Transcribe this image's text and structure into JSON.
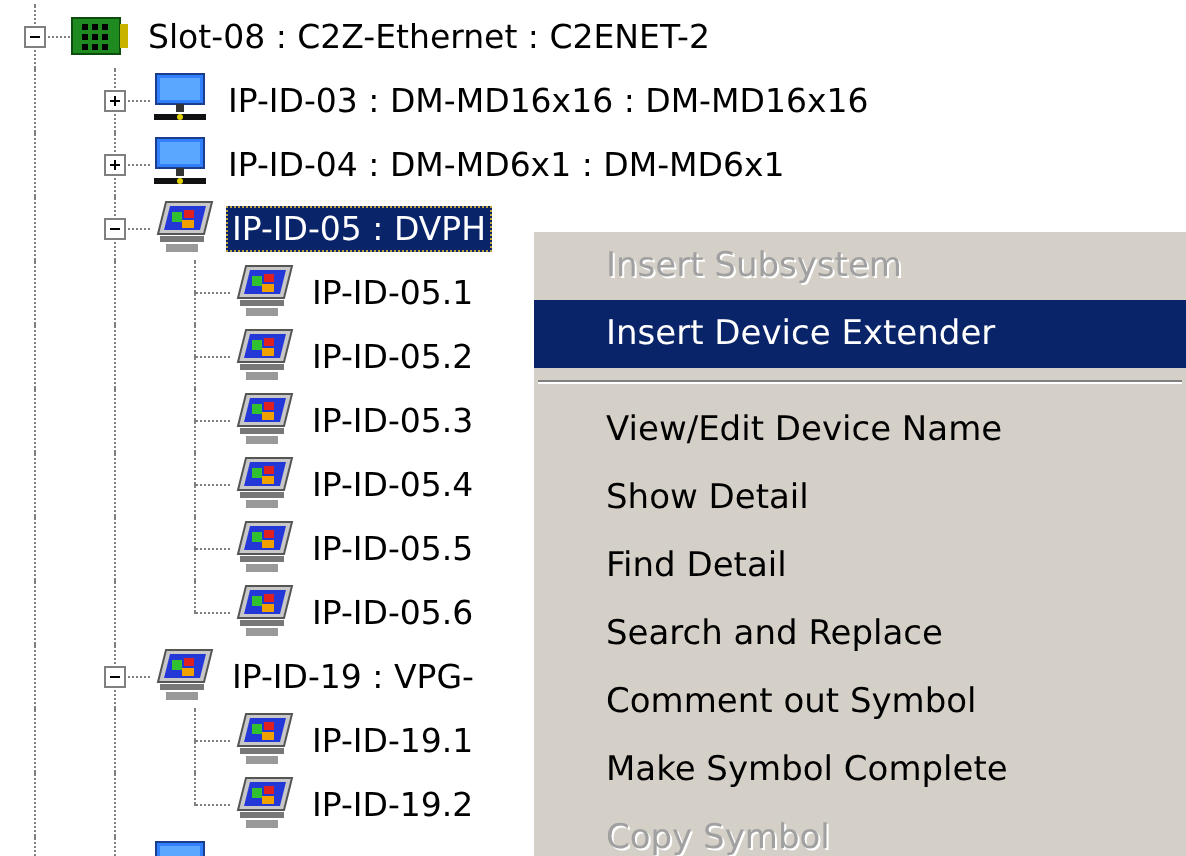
{
  "tree": [
    {
      "label": "Slot-08 : C2Z-Ethernet : C2ENET-2",
      "kind": "card",
      "expanded": true,
      "selected": false,
      "children": [
        {
          "label": "IP-ID-03 : DM-MD16x16 : DM-MD16x16",
          "kind": "switcher",
          "expanded": false,
          "selected": false
        },
        {
          "label": "IP-ID-04 : DM-MD6x1 : DM-MD6x1",
          "kind": "switcher",
          "expanded": false,
          "selected": false
        },
        {
          "label": "IP-ID-05 : DVPH",
          "kind": "panel",
          "expanded": true,
          "selected": true,
          "children": [
            {
              "label": "IP-ID-05.1",
              "kind": "panel",
              "selected": false
            },
            {
              "label": "IP-ID-05.2",
              "kind": "panel",
              "selected": false
            },
            {
              "label": "IP-ID-05.3",
              "kind": "panel",
              "selected": false
            },
            {
              "label": "IP-ID-05.4",
              "kind": "panel",
              "selected": false
            },
            {
              "label": "IP-ID-05.5",
              "kind": "panel",
              "selected": false
            },
            {
              "label": "IP-ID-05.6",
              "kind": "panel",
              "selected": false
            }
          ]
        },
        {
          "label": "IP-ID-19 : VPG-",
          "kind": "panel",
          "expanded": true,
          "selected": false,
          "children": [
            {
              "label": "IP-ID-19.1",
              "kind": "panel",
              "selected": false
            },
            {
              "label": "IP-ID-19.2",
              "kind": "panel",
              "selected": false
            }
          ]
        },
        {
          "kind": "switcher"
        }
      ]
    }
  ],
  "context_menu": {
    "items": [
      {
        "kind": "item",
        "label": "Insert Subsystem",
        "disabled": true,
        "selected": false
      },
      {
        "kind": "item",
        "label": "Insert Device Extender",
        "disabled": false,
        "selected": true
      },
      {
        "kind": "separator"
      },
      {
        "kind": "item",
        "label": "View/Edit Device Name",
        "disabled": false,
        "selected": false
      },
      {
        "kind": "item",
        "label": "Show Detail",
        "disabled": false,
        "selected": false
      },
      {
        "kind": "item",
        "label": "Find Detail",
        "disabled": false,
        "selected": false
      },
      {
        "kind": "item",
        "label": "Search and Replace",
        "disabled": false,
        "selected": false
      },
      {
        "kind": "item",
        "label": "Comment out Symbol",
        "disabled": false,
        "selected": false
      },
      {
        "kind": "item",
        "label": "Make Symbol Complete",
        "disabled": false,
        "selected": false
      },
      {
        "kind": "item",
        "label": "Copy Symbol",
        "disabled": true,
        "selected": false
      }
    ]
  }
}
